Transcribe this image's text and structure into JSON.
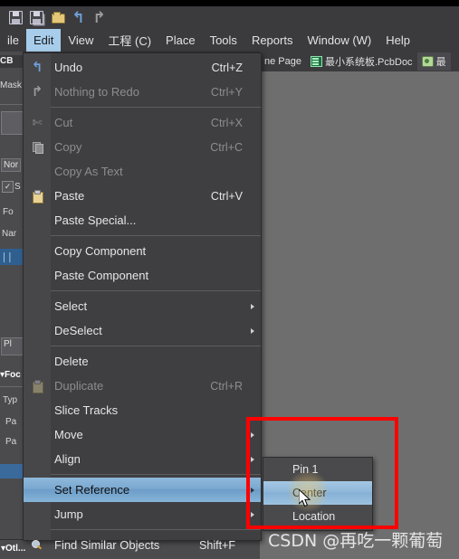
{
  "app": {
    "background_color": "#6e6e6e",
    "menu_bg": "#3f3f42",
    "highlight_color": "#7aa8d0",
    "annotation_color": "#ff0000"
  },
  "toolbar": {
    "icons": [
      {
        "name": "save-icon",
        "glyph": "floppy"
      },
      {
        "name": "save-all-icon",
        "glyph": "floppy-stack"
      },
      {
        "name": "open-folder-icon",
        "glyph": "folder"
      },
      {
        "name": "undo-icon",
        "glyph": "←"
      },
      {
        "name": "redo-icon",
        "glyph": "→"
      }
    ]
  },
  "menubar": {
    "items": [
      {
        "label": "ile",
        "mnemonic": "",
        "active": false
      },
      {
        "label": "Edit",
        "mnemonic": "E",
        "active": true
      },
      {
        "label": "View",
        "mnemonic": "V",
        "active": false
      },
      {
        "label": "工程 (C)",
        "mnemonic": "C",
        "active": false
      },
      {
        "label": "Place",
        "mnemonic": "P",
        "active": false
      },
      {
        "label": "Tools",
        "mnemonic": "T",
        "active": false
      },
      {
        "label": "Reports",
        "mnemonic": "R",
        "active": false
      },
      {
        "label": "Window (W)",
        "mnemonic": "W",
        "active": false
      },
      {
        "label": "Help",
        "mnemonic": "H",
        "active": false
      }
    ]
  },
  "tabstrip": {
    "tabs": [
      {
        "label": "ne Page",
        "icon": "",
        "selected": false
      },
      {
        "label": "最小系统板.PcbDoc",
        "icon": "pcb-icon",
        "selected": false
      },
      {
        "label": "最",
        "icon": "schematic-icon",
        "selected": true
      }
    ]
  },
  "left_panel": {
    "items": [
      {
        "label": "CB",
        "type": "tab"
      },
      {
        "label": "Mask",
        "type": "text"
      },
      {
        "label": "Nor",
        "type": "combo"
      },
      {
        "label": "S",
        "type": "checkbox",
        "checked": true
      },
      {
        "label": "Fo",
        "type": "text"
      },
      {
        "label": "Nar",
        "type": "text"
      },
      {
        "label": "Pl",
        "type": "button"
      },
      {
        "label": "Foc",
        "type": "header"
      },
      {
        "label": "Typ",
        "type": "text"
      },
      {
        "label": "Pa",
        "type": "text"
      },
      {
        "label": "Pa",
        "type": "text"
      },
      {
        "label": "Otl...",
        "type": "header"
      }
    ]
  },
  "edit_menu": {
    "items": [
      {
        "label": "Undo",
        "mnemonic": "U",
        "accel": "Ctrl+Z",
        "icon": "undo-icon",
        "disabled": false,
        "submenu": false,
        "highlighted": false
      },
      {
        "label": "Nothing to Redo",
        "mnemonic": "",
        "accel": "Ctrl+Y",
        "icon": "redo-icon",
        "disabled": true,
        "submenu": false,
        "highlighted": false
      },
      {
        "separator": true
      },
      {
        "label": "Cut",
        "mnemonic": "t",
        "accel": "Ctrl+X",
        "icon": "cut-icon",
        "disabled": true,
        "submenu": false,
        "highlighted": false
      },
      {
        "label": "Copy",
        "mnemonic": "C",
        "accel": "Ctrl+C",
        "icon": "copy-icon",
        "disabled": true,
        "submenu": false,
        "highlighted": false
      },
      {
        "label": "Copy As Text",
        "mnemonic": "",
        "accel": "",
        "icon": "",
        "disabled": true,
        "submenu": false,
        "highlighted": false
      },
      {
        "label": "Paste",
        "mnemonic": "P",
        "accel": "Ctrl+V",
        "icon": "paste-icon",
        "disabled": false,
        "submenu": false,
        "highlighted": false
      },
      {
        "label": "Paste Special...",
        "mnemonic": "a",
        "accel": "",
        "icon": "",
        "disabled": false,
        "submenu": false,
        "highlighted": false
      },
      {
        "separator": true
      },
      {
        "label": "Copy Component",
        "mnemonic": "y",
        "accel": "",
        "icon": "",
        "disabled": false,
        "submenu": false,
        "highlighted": false
      },
      {
        "label": "Paste Component",
        "mnemonic": "o",
        "accel": "",
        "icon": "",
        "disabled": false,
        "submenu": false,
        "highlighted": false
      },
      {
        "separator": true
      },
      {
        "label": "Select",
        "mnemonic": "S",
        "accel": "",
        "icon": "",
        "disabled": false,
        "submenu": true,
        "highlighted": false
      },
      {
        "label": "DeSelect",
        "mnemonic": "e",
        "accel": "",
        "icon": "",
        "disabled": false,
        "submenu": true,
        "highlighted": false
      },
      {
        "separator": true
      },
      {
        "label": "Delete",
        "mnemonic": "D",
        "accel": "",
        "icon": "",
        "disabled": false,
        "submenu": false,
        "highlighted": false
      },
      {
        "label": "Duplicate",
        "mnemonic": "",
        "accel": "Ctrl+R",
        "icon": "duplicate-icon",
        "disabled": true,
        "submenu": false,
        "highlighted": false
      },
      {
        "label": "Slice Tracks",
        "mnemonic": "c",
        "accel": "",
        "icon": "",
        "disabled": false,
        "submenu": false,
        "highlighted": false
      },
      {
        "label": "Move",
        "mnemonic": "M",
        "accel": "",
        "icon": "",
        "disabled": false,
        "submenu": true,
        "highlighted": false
      },
      {
        "label": "Align",
        "mnemonic": "A",
        "accel": "",
        "icon": "",
        "disabled": false,
        "submenu": true,
        "highlighted": false
      },
      {
        "separator": true
      },
      {
        "label": "Set Reference",
        "mnemonic": "f",
        "accel": "",
        "icon": "",
        "disabled": false,
        "submenu": true,
        "highlighted": true
      },
      {
        "label": "Jump",
        "mnemonic": "J",
        "accel": "",
        "icon": "",
        "disabled": false,
        "submenu": true,
        "highlighted": false
      },
      {
        "separator": true
      },
      {
        "label": "Find Similar Objects",
        "mnemonic": "d",
        "accel": "Shift+F",
        "icon": "find-icon",
        "disabled": false,
        "submenu": false,
        "highlighted": false
      }
    ]
  },
  "submenu": {
    "parent": "Set Reference",
    "items": [
      {
        "label": "Pin 1",
        "mnemonic": "P",
        "highlighted": false
      },
      {
        "label": "Center",
        "mnemonic": "C",
        "highlighted": true
      },
      {
        "label": "Location",
        "mnemonic": "L",
        "highlighted": false
      }
    ]
  },
  "annotation": {
    "watermark": "CSDN @再吃一颗葡萄",
    "rect_color": "#ff0000"
  }
}
